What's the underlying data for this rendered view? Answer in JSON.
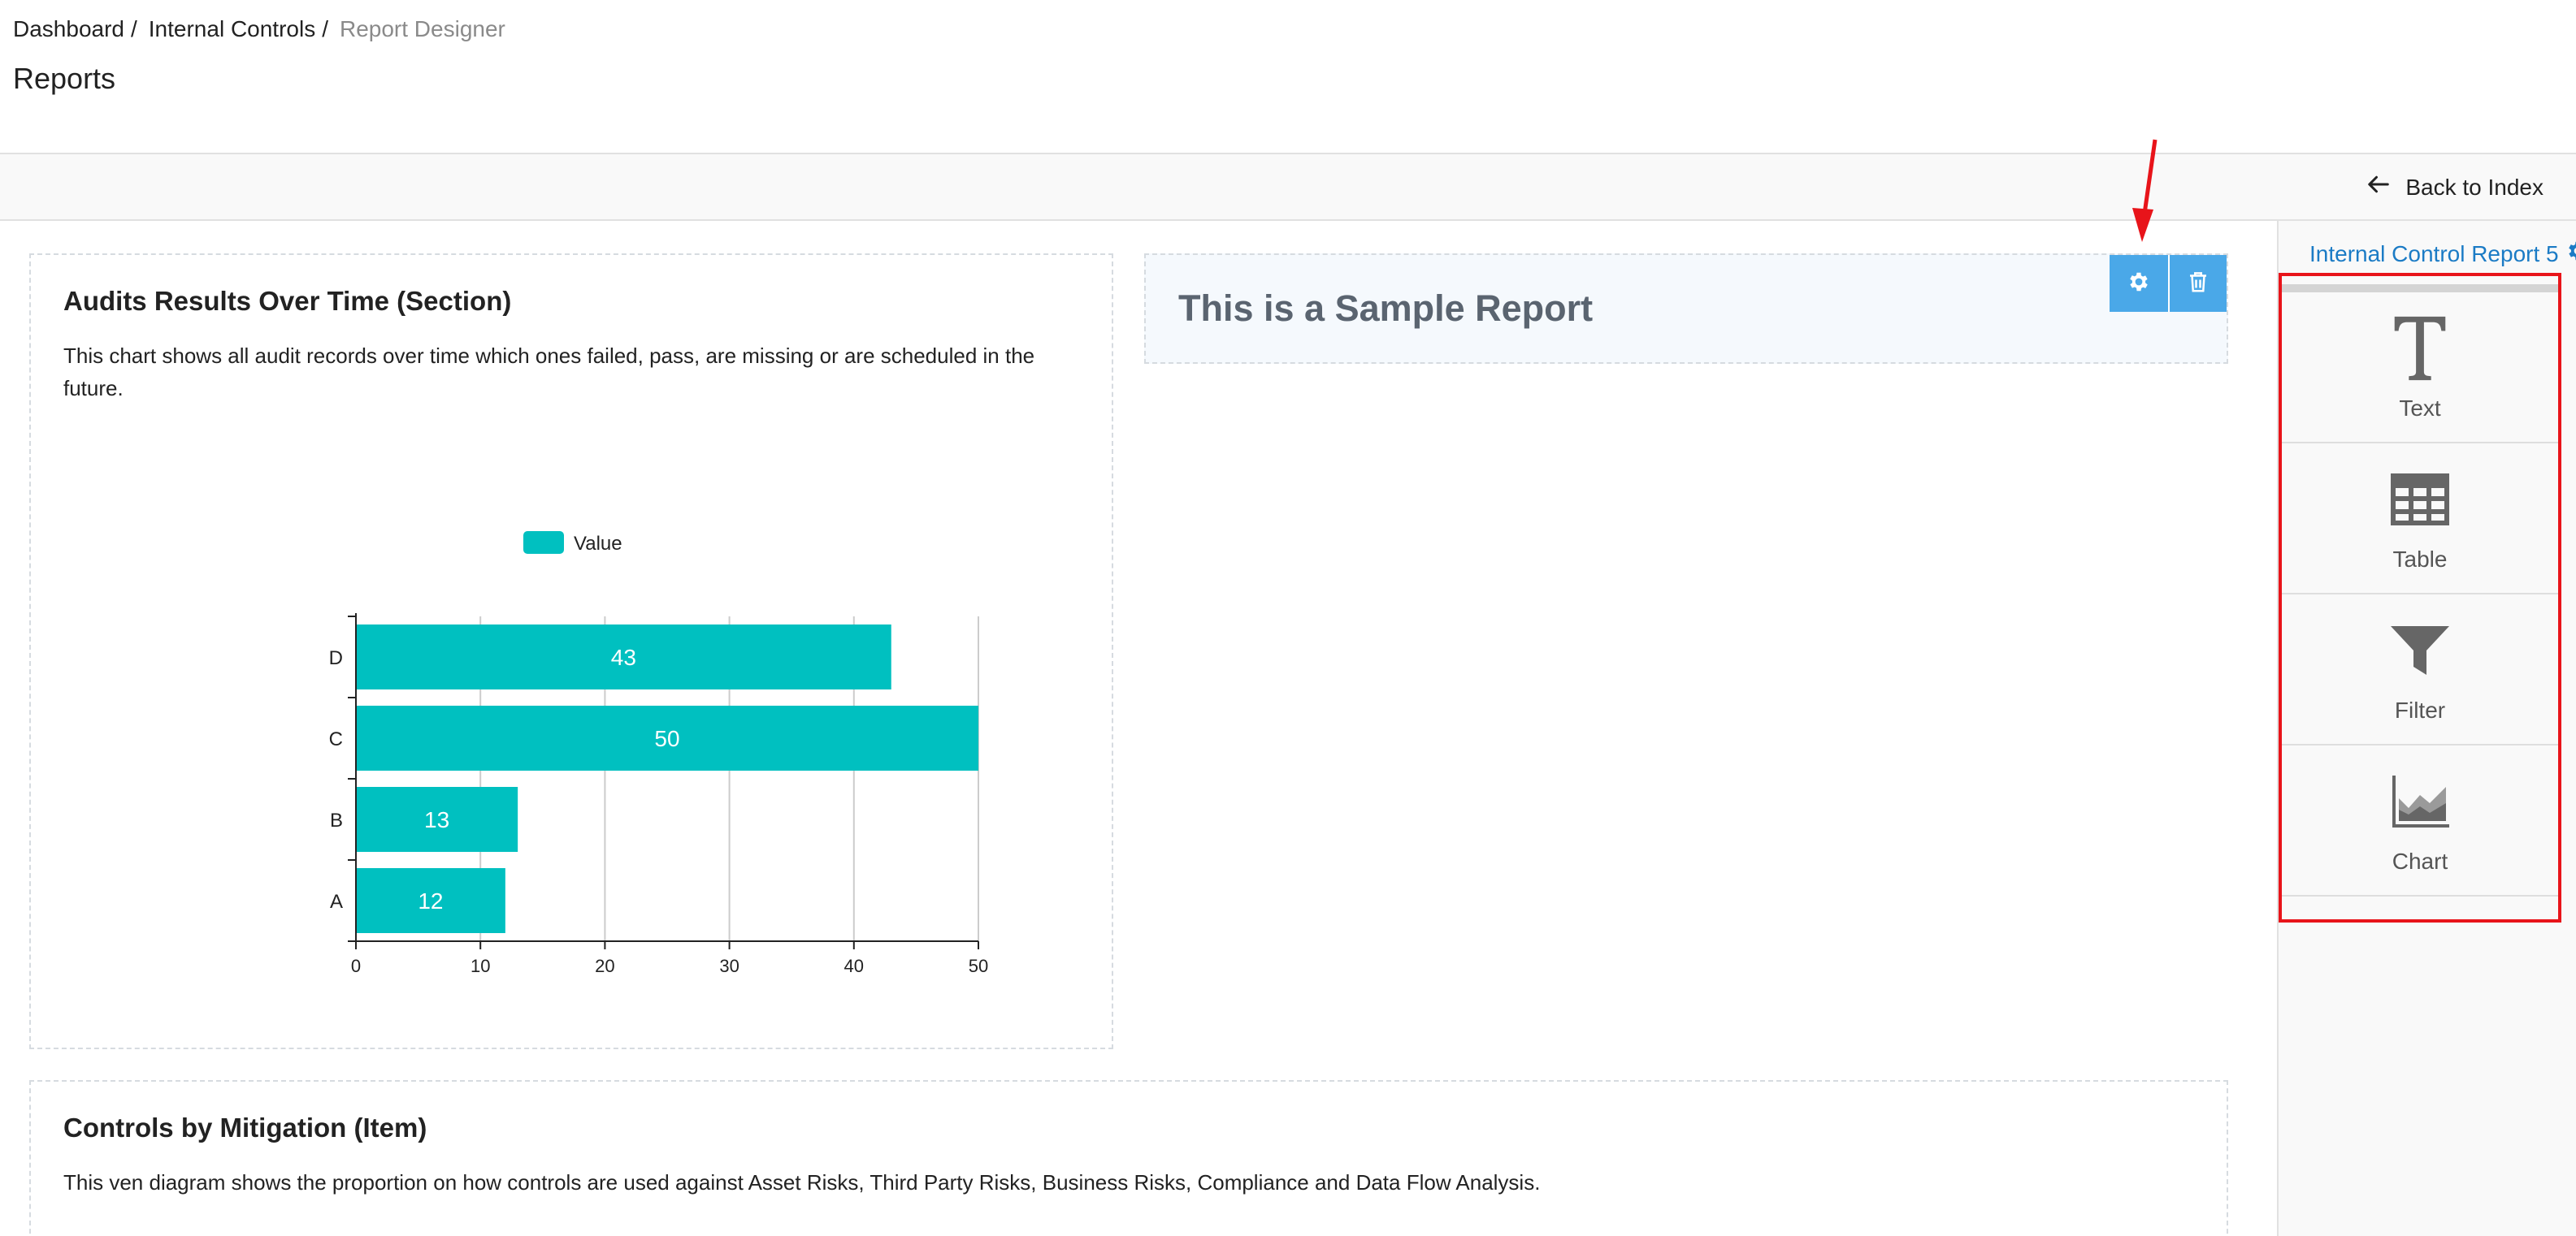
{
  "breadcrumb": {
    "items": [
      "Dashboard",
      "Internal Controls"
    ],
    "current": "Report Designer",
    "separator": "/"
  },
  "page": {
    "title": "Reports"
  },
  "toolbar": {
    "back_label": "Back to Index"
  },
  "sidebar": {
    "report_name": "Internal Control Report 5",
    "tools": [
      {
        "label": "Text",
        "icon": "text-icon"
      },
      {
        "label": "Table",
        "icon": "table-icon"
      },
      {
        "label": "Filter",
        "icon": "filter-icon"
      },
      {
        "label": "Chart",
        "icon": "chart-icon"
      }
    ]
  },
  "sections": {
    "audits": {
      "title": "Audits Results Over Time (Section)",
      "description": "This chart shows all audit records over time which ones failed, pass, are missing or are scheduled in the future."
    },
    "sample": {
      "title": "This is a Sample Report"
    },
    "controls": {
      "title": "Controls by Mitigation (Item)",
      "description": "This ven diagram shows the proportion on how controls are used against Asset Risks, Third Party Risks, Business Risks, Compliance and Data Flow Analysis."
    }
  },
  "colors": {
    "accent": "#4aa8e8",
    "bar": "#00c0c0",
    "link": "#1b7bc5",
    "highlight": "#e8141a"
  },
  "chart_data": {
    "type": "bar",
    "orientation": "horizontal",
    "categories": [
      "D",
      "C",
      "B",
      "A"
    ],
    "series": [
      {
        "name": "Value",
        "values": [
          43,
          50,
          13,
          12
        ]
      }
    ],
    "xlim": [
      0,
      50
    ],
    "xticks": [
      0,
      10,
      20,
      30,
      40,
      50
    ],
    "legend": "top-center",
    "grid": true,
    "data_labels": true
  }
}
